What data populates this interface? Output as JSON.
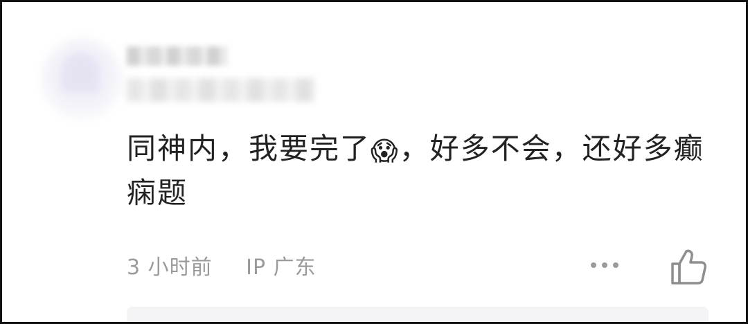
{
  "comment": {
    "text_part1": "同神内，我要完了",
    "emoji": "😱",
    "text_part2": "，好多不会，还好多癫痫题"
  },
  "footer": {
    "time": "3 小时前",
    "ip": "IP 广东"
  },
  "icons": {
    "more": "more-horizontal-icon",
    "like": "thumbs-up-icon"
  },
  "colors": {
    "text": "#222222",
    "meta": "#9a9a9a"
  }
}
